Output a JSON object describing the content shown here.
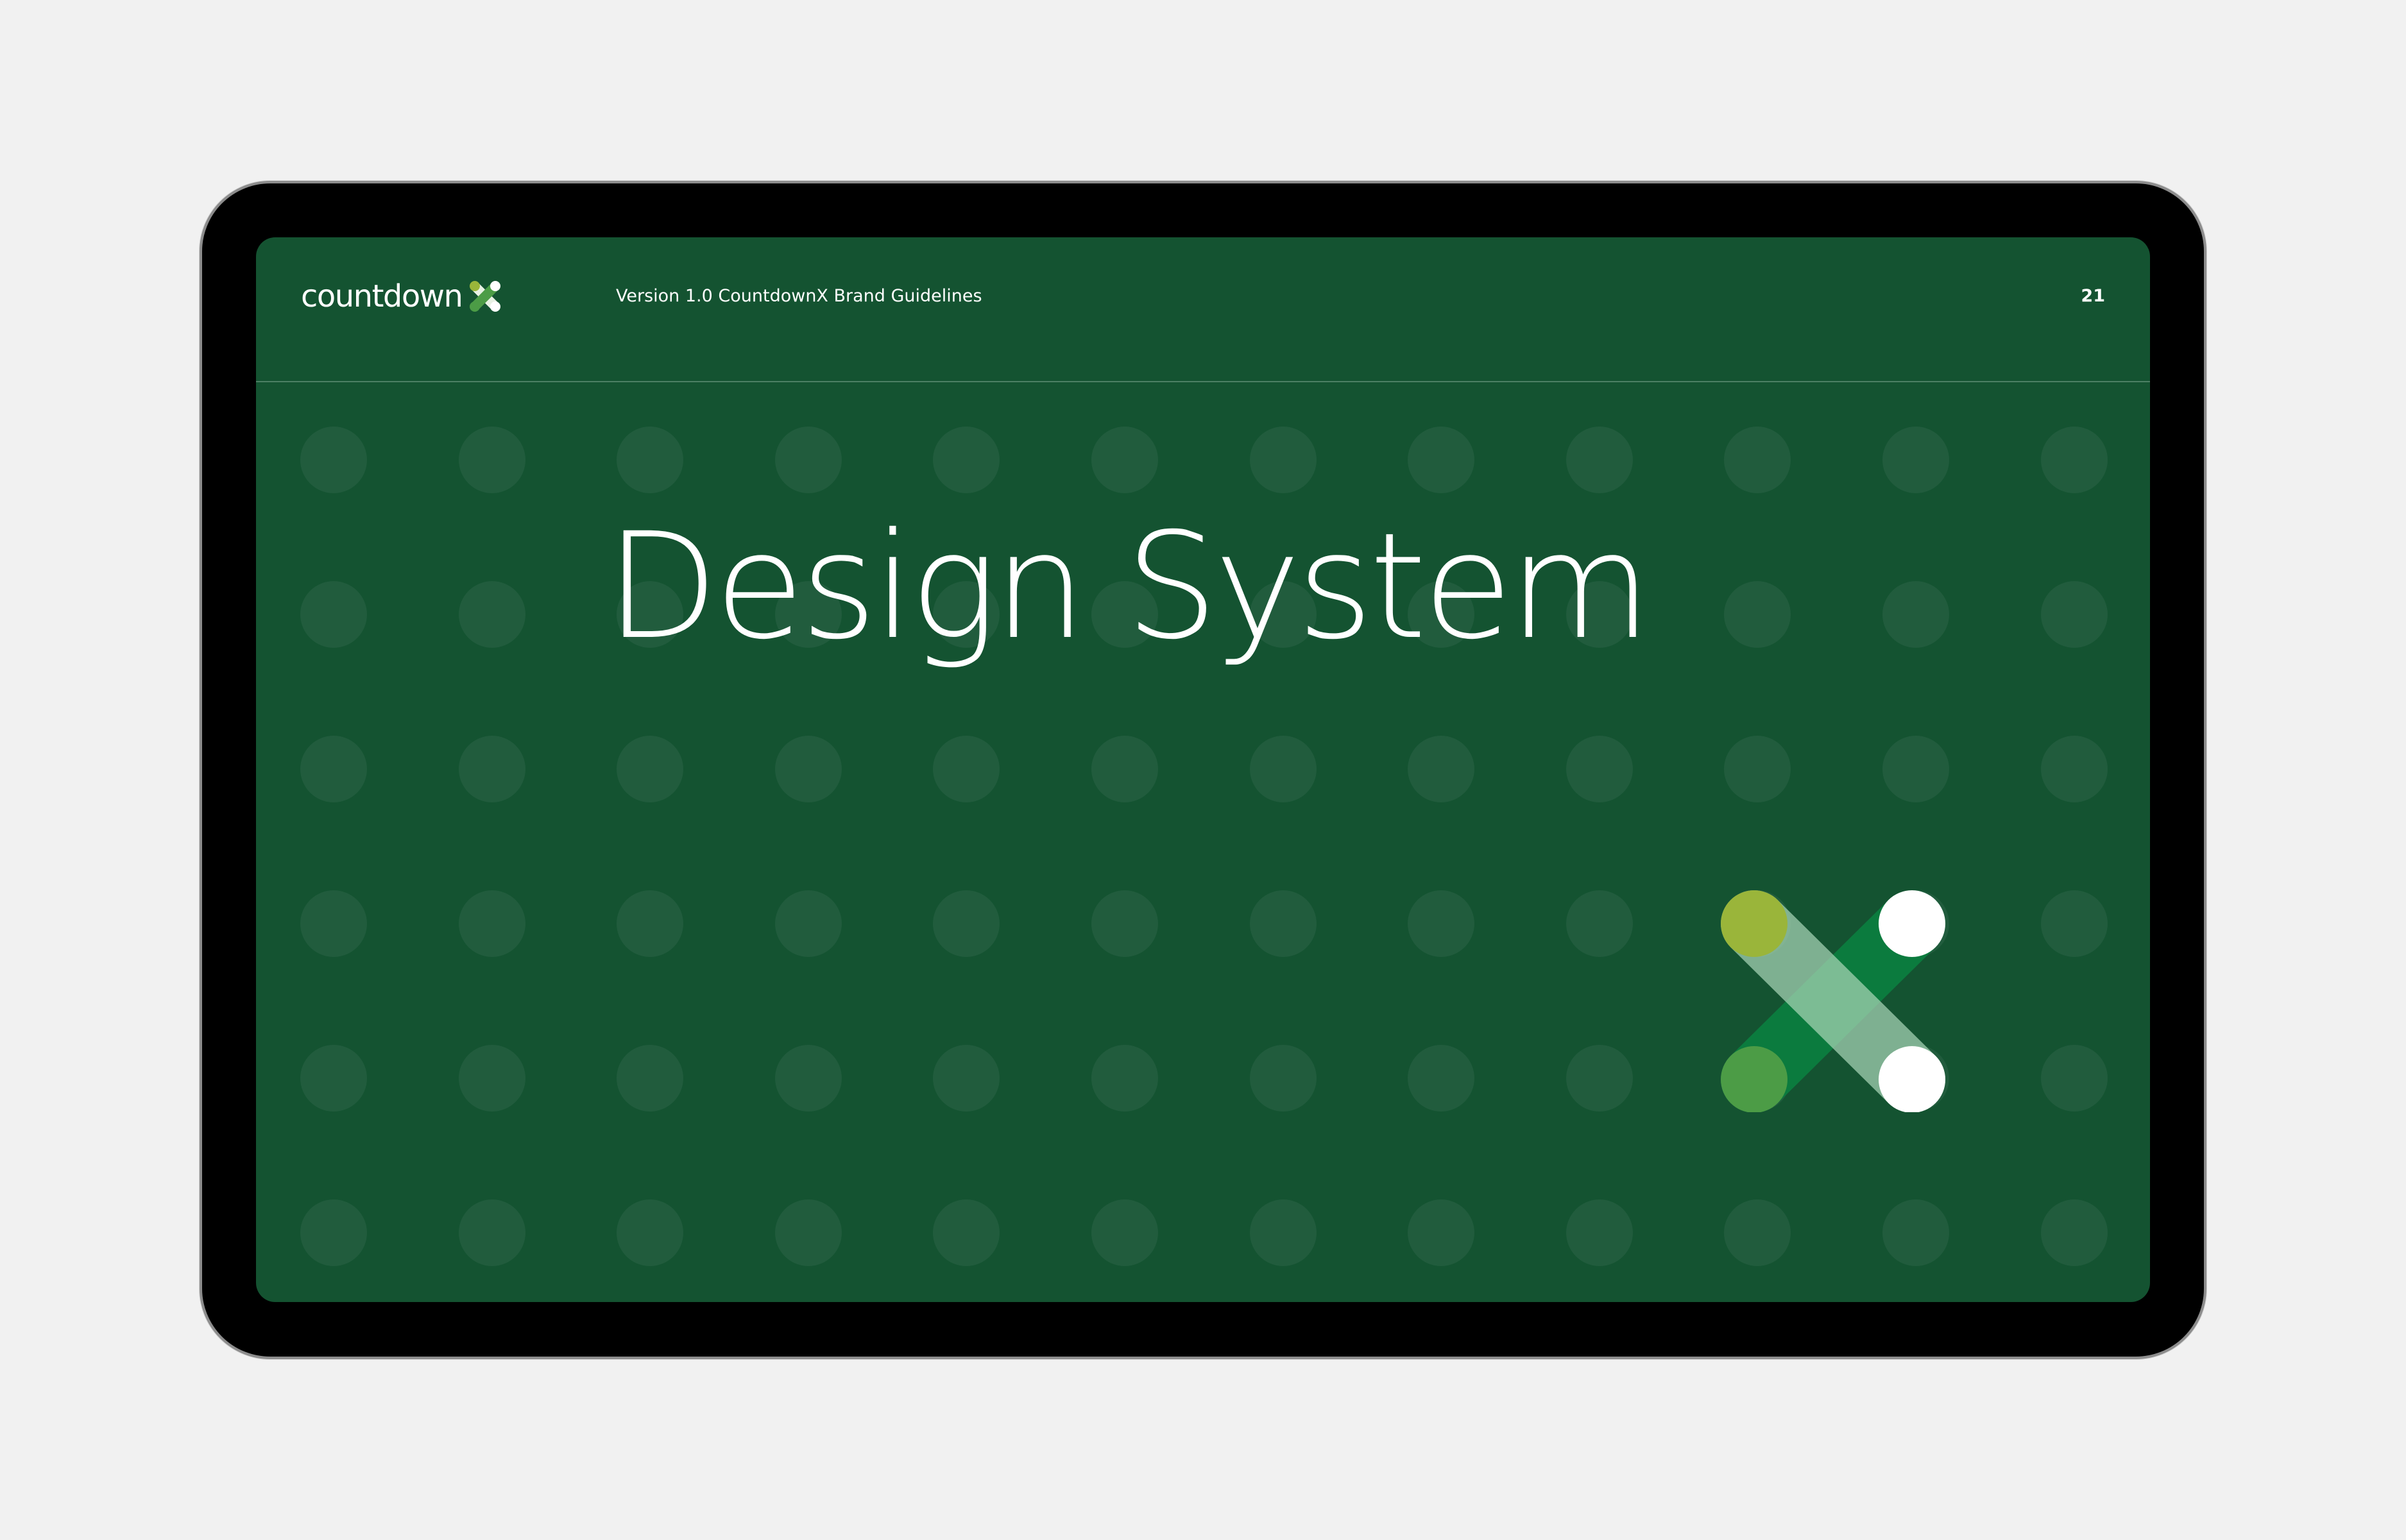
{
  "header": {
    "logo_text": "countdown",
    "version_text": "Version 1.0 CountdownX Brand Guidelines",
    "page_number": "21"
  },
  "main": {
    "title": "Design System"
  },
  "logo_mark": {
    "icon": "countdown-x-icon",
    "colors": [
      "#9ab53a",
      "#4c9c46",
      "#ffffff"
    ]
  },
  "x_mark": {
    "icon": "x-mark-graphic-icon",
    "colors": {
      "lime": "#9ab53a",
      "green": "#4c9c46",
      "dark_band": "#0b7b3e",
      "light_band": "#a8d5b6",
      "white": "#ffffff"
    }
  },
  "colors": {
    "background": "#f1f1f1",
    "device_frame": "#000000",
    "screen": "#145331",
    "dots": "#215c3d"
  }
}
